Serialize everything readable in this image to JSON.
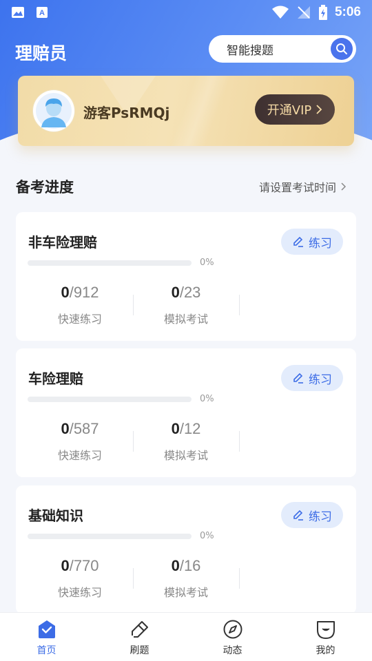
{
  "status_bar": {
    "time": "5:06"
  },
  "header": {
    "title": "理赔员",
    "search_placeholder": "智能搜题"
  },
  "vip_card": {
    "username": "游客PsRMQj",
    "vip_button": "开通VIP"
  },
  "section": {
    "title": "备考进度",
    "set_time_link": "请设置考试时间"
  },
  "cards": [
    {
      "title": "非车险理赔",
      "practice_label": "练习",
      "progress": 0,
      "progress_text": "0%",
      "quick_done": "0",
      "quick_total": "/912",
      "quick_label": "快速练习",
      "mock_done": "0",
      "mock_total": "/23",
      "mock_label": "模拟考试"
    },
    {
      "title": "车险理赔",
      "practice_label": "练习",
      "progress": 0,
      "progress_text": "0%",
      "quick_done": "0",
      "quick_total": "/587",
      "quick_label": "快速练习",
      "mock_done": "0",
      "mock_total": "/12",
      "mock_label": "模拟考试"
    },
    {
      "title": "基础知识",
      "practice_label": "练习",
      "progress": 0,
      "progress_text": "0%",
      "quick_done": "0",
      "quick_total": "/770",
      "quick_label": "快速练习",
      "mock_done": "0",
      "mock_total": "/16",
      "mock_label": "模拟考试"
    }
  ],
  "bottom_nav": [
    {
      "label": "首页",
      "icon": "home-icon",
      "active": true
    },
    {
      "label": "刷题",
      "icon": "pencil-icon",
      "active": false
    },
    {
      "label": "动态",
      "icon": "compass-icon",
      "active": false
    },
    {
      "label": "我的",
      "icon": "profile-icon",
      "active": false
    }
  ],
  "colors": {
    "primary": "#3c6ce6",
    "header_gradient_start": "#3d73ee",
    "vip_gold": "#f2dca8"
  }
}
